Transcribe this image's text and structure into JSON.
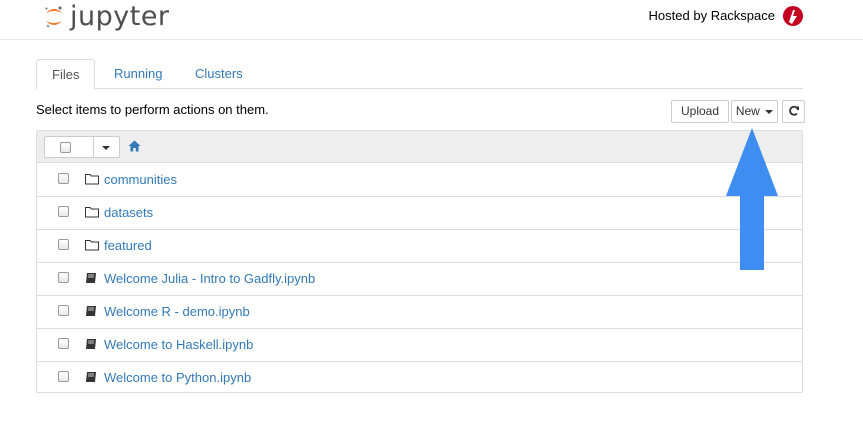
{
  "header": {
    "logo_text": "jupyter",
    "hosted_text": "Hosted by Rackspace",
    "brand_accent": "#f37726",
    "rackspace_color": "#c40022"
  },
  "tabs": [
    {
      "label": "Files",
      "active": true
    },
    {
      "label": "Running",
      "active": false
    },
    {
      "label": "Clusters",
      "active": false
    }
  ],
  "toolbar": {
    "hint": "Select items to perform actions on them.",
    "upload_label": "Upload",
    "new_label": "New",
    "refresh_icon": "refresh-icon"
  },
  "list": {
    "home_icon": "home-icon",
    "items": [
      {
        "name": "communities",
        "type": "folder"
      },
      {
        "name": "datasets",
        "type": "folder"
      },
      {
        "name": "featured",
        "type": "folder"
      },
      {
        "name": "Welcome Julia - Intro to Gadfly.ipynb",
        "type": "notebook"
      },
      {
        "name": "Welcome R - demo.ipynb",
        "type": "notebook"
      },
      {
        "name": "Welcome to Haskell.ipynb",
        "type": "notebook"
      },
      {
        "name": "Welcome to Python.ipynb",
        "type": "notebook"
      }
    ]
  },
  "annotation": {
    "arrow_color": "#3d8ef0",
    "arrow_target": "new-button"
  }
}
